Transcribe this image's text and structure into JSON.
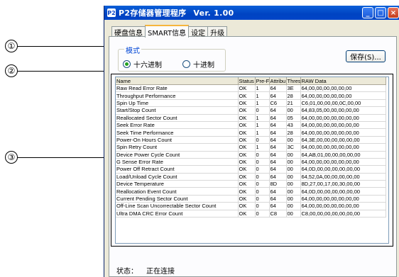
{
  "window": {
    "title": "P2存储器管理程序",
    "version": "Ver. 1.00",
    "app_icon": "P2",
    "controls": {
      "minimize": "_",
      "maximize": "□",
      "close": "×"
    }
  },
  "tabs": [
    {
      "label": "硬盘信息"
    },
    {
      "label": "SMART信息"
    },
    {
      "label": "设定"
    },
    {
      "label": "升级"
    }
  ],
  "mode": {
    "legend": "模式",
    "options": [
      {
        "label": "十六进制",
        "selected": true
      },
      {
        "label": "十进制",
        "selected": false
      }
    ]
  },
  "save_button": "保存(S)...",
  "callouts": [
    "①",
    "②",
    "③"
  ],
  "table": {
    "headers": [
      "Name",
      "Status",
      "Pre-Fa",
      "Attribu",
      "Thresh",
      "RAW Data"
    ],
    "rows": [
      [
        "Raw Read Error Rate",
        "OK",
        "1",
        "64",
        "3E",
        "64,00,00,00,00,00,00"
      ],
      [
        "Throughput Performance",
        "OK",
        "1",
        "64",
        "28",
        "64,00,00,00,00,00,00"
      ],
      [
        "Spin Up Time",
        "OK",
        "1",
        "C6",
        "21",
        "C6,01,00,00,00,0C,00,00"
      ],
      [
        "Start/Stop Count",
        "OK",
        "0",
        "64",
        "00",
        "64,83,05,00,00,00,00,00"
      ],
      [
        "Reallocated Sector Count",
        "OK",
        "1",
        "64",
        "05",
        "64,00,00,00,00,00,00,00"
      ],
      [
        "Seek Error Rate",
        "OK",
        "1",
        "64",
        "43",
        "64,00,00,00,00,00,00,00"
      ],
      [
        "Seek Time Performance",
        "OK",
        "1",
        "64",
        "28",
        "64,00,00,00,00,00,00,00"
      ],
      [
        "Power-On Hours Count",
        "OK",
        "0",
        "64",
        "00",
        "64,3E,00,00,00,00,00,00"
      ],
      [
        "Spin Retry Count",
        "OK",
        "1",
        "64",
        "3C",
        "64,00,00,00,00,00,00,00"
      ],
      [
        "Device Power Cycle Count",
        "OK",
        "0",
        "64",
        "00",
        "64,AB,01,00,00,00,00,00"
      ],
      [
        "G Sense Error Rate",
        "OK",
        "0",
        "64",
        "00",
        "64,00,00,00,00,00,00,00"
      ],
      [
        "Power Off Retract Count",
        "OK",
        "0",
        "64",
        "00",
        "64,0D,00,00,00,00,00,00"
      ],
      [
        "Load/Unload Cycle Count",
        "OK",
        "0",
        "64",
        "00",
        "64,52,0A,00,00,00,00,00"
      ],
      [
        "Device Temperature",
        "OK",
        "0",
        "8D",
        "00",
        "8D,27,00,17,00,30,00,00"
      ],
      [
        "Reallocation Event Count",
        "OK",
        "0",
        "64",
        "00",
        "64,0D,00,00,00,00,00,00"
      ],
      [
        "Current Pending Sector Count",
        "OK",
        "0",
        "64",
        "00",
        "64,00,00,00,00,00,00,00"
      ],
      [
        "Off-Line Scan Uncorrectable Sector Count",
        "OK",
        "0",
        "64",
        "00",
        "64,00,00,00,00,00,00,00"
      ],
      [
        "Ultra DMA CRC Error Count",
        "OK",
        "0",
        "C8",
        "00",
        "C8,00,00,00,00,00,00,00"
      ]
    ]
  },
  "status": {
    "label": "状态：",
    "value": "正在连接"
  }
}
